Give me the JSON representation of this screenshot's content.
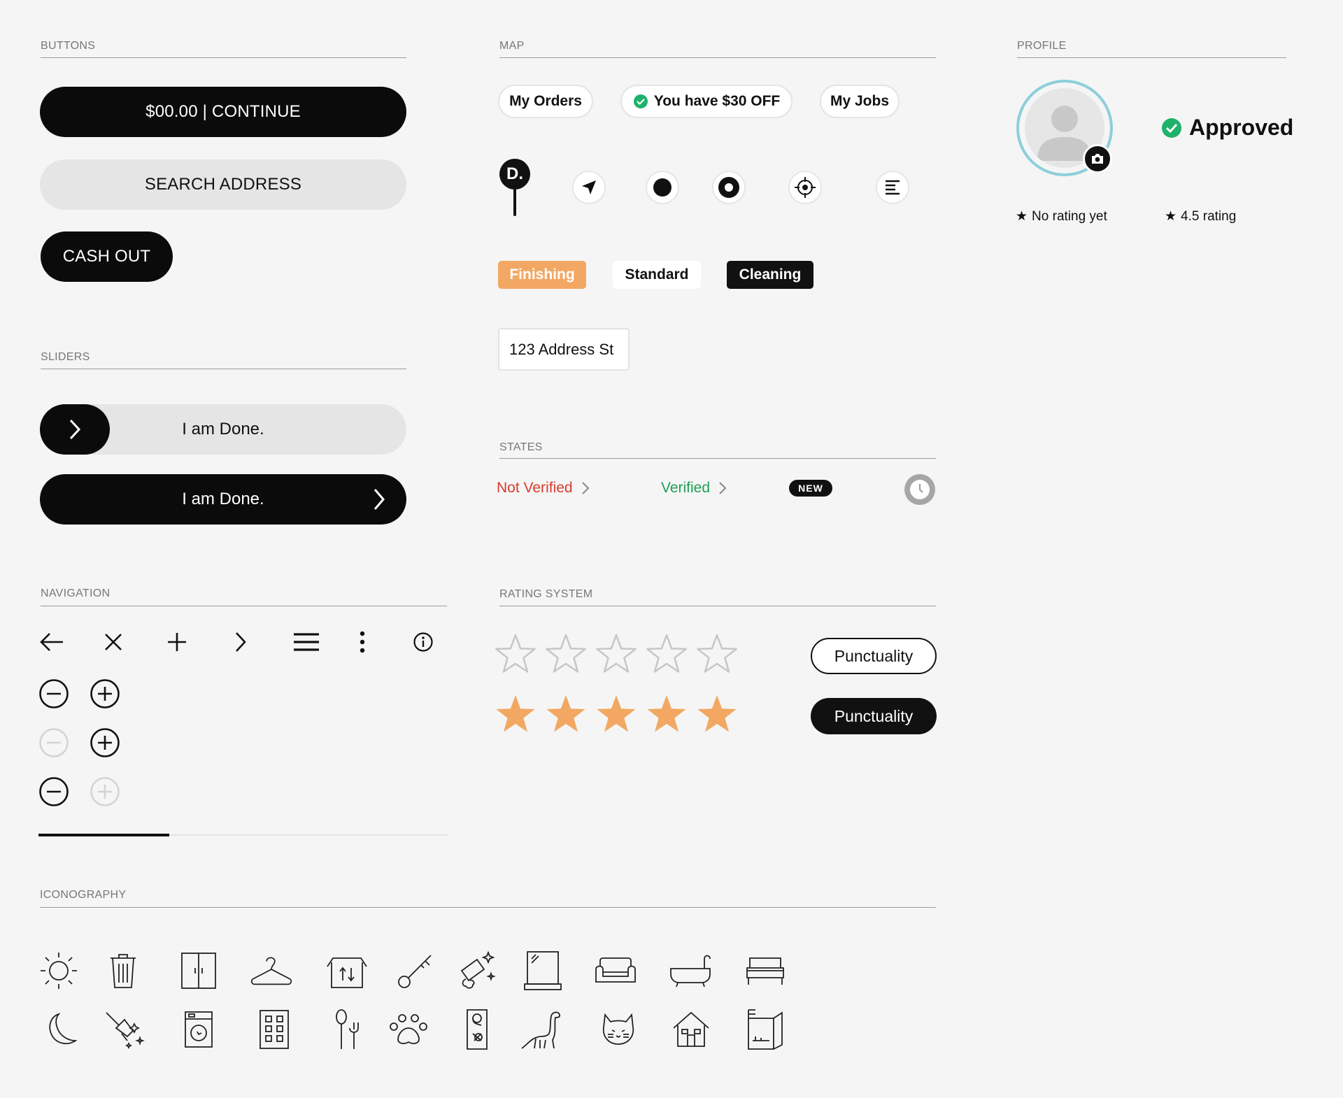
{
  "sections": {
    "buttons": "BUTTONS",
    "map": "MAP",
    "profile": "PROFILE",
    "sliders": "SLIDERS",
    "states": "STATES",
    "navigation": "NAVIGATION",
    "rating_system": "RATING SYSTEM",
    "iconography": "ICONOGRAPHY"
  },
  "buttons": {
    "continue_label": "$00.00 | CONTINUE",
    "search_label": "SEARCH ADDRESS",
    "cashout_label": "CASH OUT"
  },
  "sliders": {
    "light_label": "I am Done.",
    "dark_label": "I am Done."
  },
  "map": {
    "chips": [
      "My Orders",
      "You have $30 OFF",
      "My Jobs"
    ],
    "pin_letter": "D.",
    "tags": [
      "Finishing",
      "Standard",
      "Cleaning"
    ],
    "address": "123 Address St"
  },
  "states": {
    "not_verified": "Not Verified",
    "verified": "Verified",
    "new_badge": "NEW"
  },
  "rating": {
    "empty_stars": 0,
    "filled_stars": 5,
    "max_stars": 5,
    "pill_outline": "Punctuality",
    "pill_filled": "Punctuality"
  },
  "profile": {
    "status": "Approved",
    "no_rating": "No rating yet",
    "rating": "4.5 rating"
  },
  "navigation": {
    "icons": [
      "back-arrow-icon",
      "close-icon",
      "plus-icon",
      "chevron-right-icon",
      "hamburger-menu-icon",
      "more-vertical-icon",
      "info-icon"
    ],
    "progress": 0.32
  },
  "iconography": {
    "row1": [
      "sun-icon",
      "trash-icon",
      "wardrobe-icon",
      "hanger-icon",
      "moving-box-icon",
      "key-icon",
      "sparkle-cleaning-icon",
      "window-icon",
      "sofa-icon",
      "bathtub-icon",
      "bed-icon"
    ],
    "row2": [
      "moon-icon",
      "broom-sparkle-icon",
      "washing-machine-icon",
      "building-icon",
      "utensils-icon",
      "paw-icon",
      "door-hanger-icon",
      "dinosaur-icon",
      "cat-icon",
      "house-icon",
      "fridge-icon"
    ]
  },
  "colors": {
    "accent_orange": "#f2a862",
    "star_grey": "#c6c6c6",
    "verified_green": "#1f9e55",
    "error_red": "#d93b2b",
    "avatar_ring": "#8ccfdb",
    "approved_green": "#1fb26b"
  }
}
